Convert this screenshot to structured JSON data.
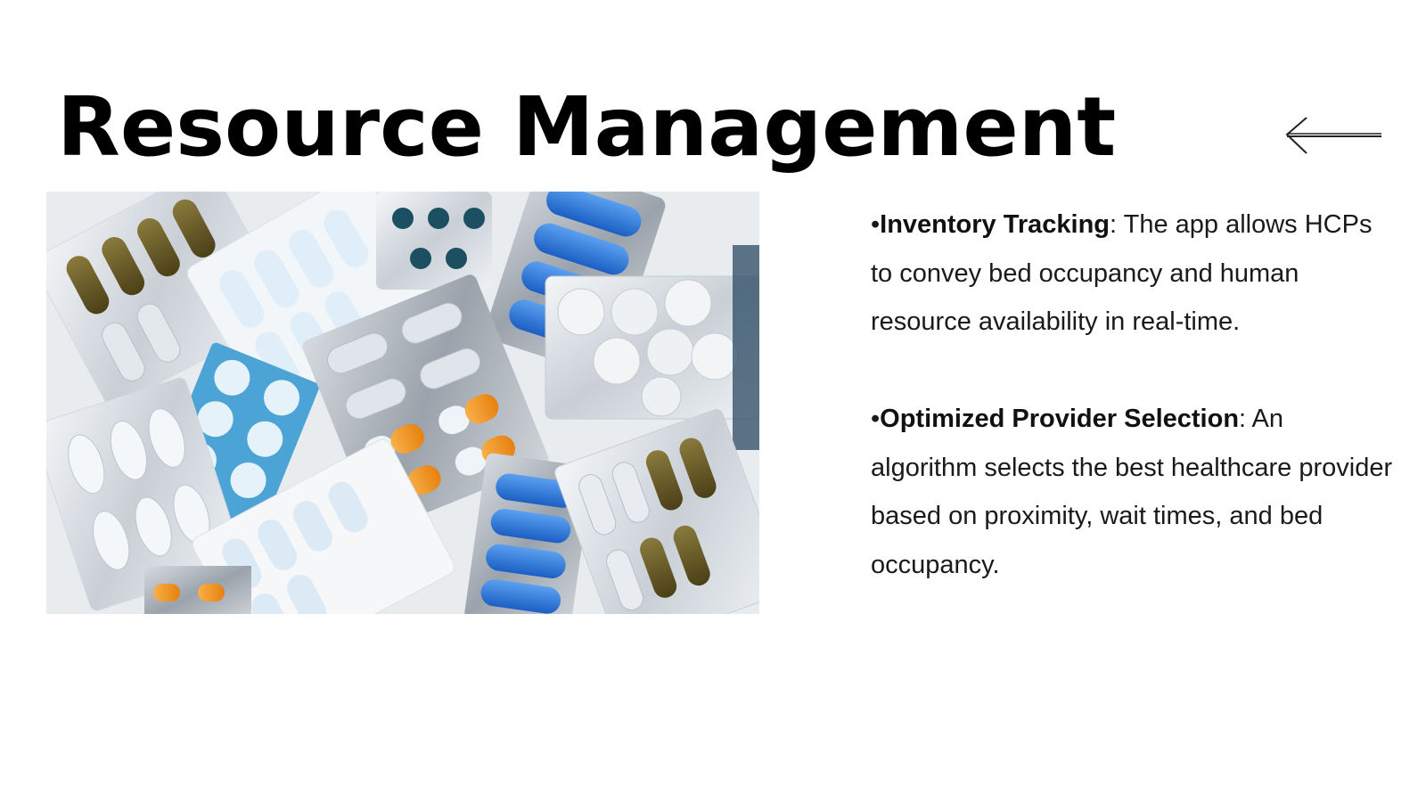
{
  "slide": {
    "title": "Resource Management",
    "back_icon": "left-arrow-icon",
    "image_subject": "blister-packs-of-pills-photo",
    "bullets": [
      {
        "marker": "•",
        "term": "Inventory Tracking",
        "text": ": The app allows HCPs to convey bed occupancy and human resource availability in real-time."
      },
      {
        "marker": "•",
        "term": "Optimized Provider Selection",
        "text": ": An algorithm selects the best healthcare provider based on proximity, wait times, and bed occupancy."
      }
    ]
  }
}
